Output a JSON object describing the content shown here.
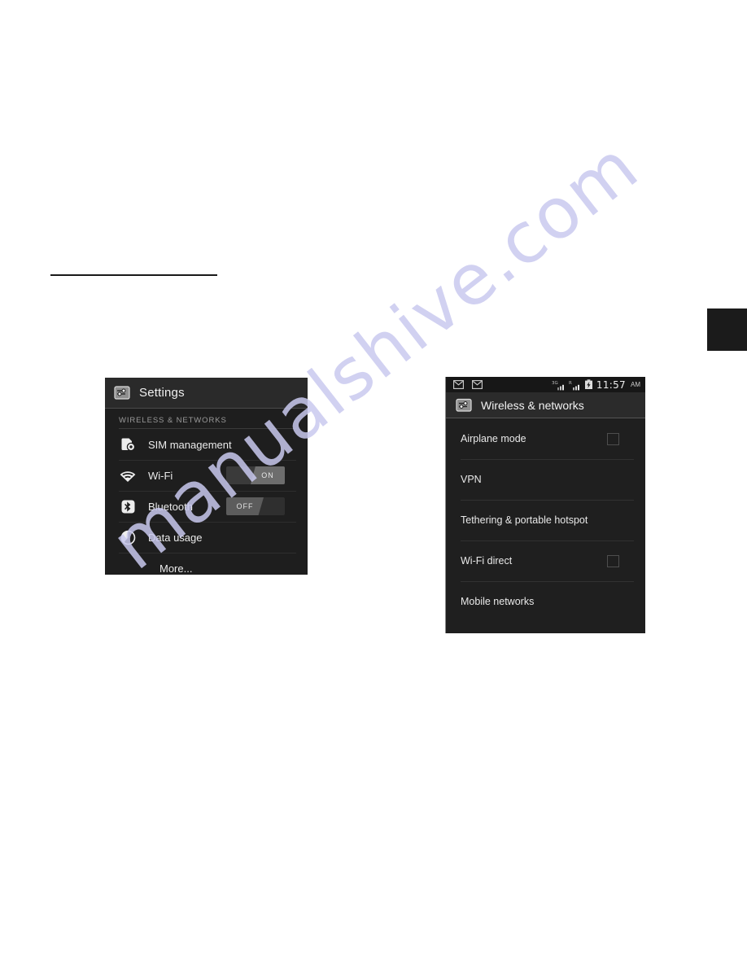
{
  "page": {
    "rule": "horizontal-rule",
    "edge_tab": "chapter-tab",
    "watermark_text": "manualshive.com",
    "watermark_color": "#c9c9ef"
  },
  "settings_panel": {
    "header": {
      "icon": "settings-sliders-icon",
      "title": "Settings"
    },
    "section_label": "WIRELESS & NETWORKS",
    "rows": [
      {
        "icon": "sim-card-icon",
        "label": "SIM management",
        "control": "none"
      },
      {
        "icon": "wifi-icon",
        "label": "Wi-Fi",
        "control": "toggle",
        "toggle_state": "ON"
      },
      {
        "icon": "bluetooth-icon",
        "label": "Bluetooth",
        "control": "toggle",
        "toggle_state": "OFF"
      },
      {
        "icon": "pie-chart-icon",
        "label": "Data usage",
        "control": "none"
      },
      {
        "icon": "none",
        "label": "More...",
        "control": "none"
      }
    ]
  },
  "wireless_panel": {
    "statusbar": {
      "left_icons": [
        "message-envelope-icon",
        "message-envelope-icon"
      ],
      "right_icons": [
        "signal-3g-icon",
        "signal-roaming-icon",
        "battery-charging-icon"
      ],
      "signal_3g_label": "3G",
      "signal_roaming_label": "R",
      "time": "11:57",
      "ampm": "AM"
    },
    "header": {
      "icon": "settings-sliders-icon",
      "title": "Wireless & networks"
    },
    "rows": [
      {
        "label": "Airplane mode",
        "control": "checkbox",
        "checked": false
      },
      {
        "label": "VPN",
        "control": "none"
      },
      {
        "label": "Tethering & portable hotspot",
        "control": "none"
      },
      {
        "label": "Wi-Fi direct",
        "control": "checkbox",
        "checked": false
      },
      {
        "label": "Mobile networks",
        "control": "none"
      }
    ]
  }
}
